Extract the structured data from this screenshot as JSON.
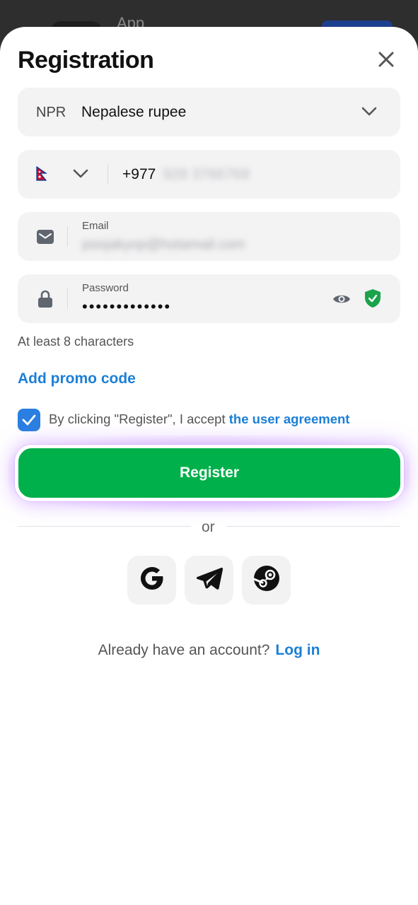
{
  "background_app": {
    "title": "App"
  },
  "sheet": {
    "title": "Registration",
    "close_icon": "close-icon"
  },
  "currency": {
    "code": "NPR",
    "name": "Nepalese rupee",
    "icon": "chevron-down-icon"
  },
  "phone": {
    "country_flag": "nepal-flag-icon",
    "prefix": "+977",
    "number_blurred": "928 3766769"
  },
  "email": {
    "label": "Email",
    "value_blurred": "poojakyop@hotamail.com",
    "icon": "envelope-icon"
  },
  "password": {
    "label": "Password",
    "value_masked": "•••••••••••••",
    "icon": "lock-icon",
    "reveal_icon": "eye-icon",
    "strength_icon": "shield-check-icon"
  },
  "password_hint": "At least 8 characters",
  "promo_link": "Add promo code",
  "agreement": {
    "checked": true,
    "text": "By clicking \"Register\", I accept",
    "link_text": "the user agreement"
  },
  "register_button": "Register",
  "divider_text": "or",
  "social": [
    {
      "name": "google",
      "icon": "google-icon"
    },
    {
      "name": "telegram",
      "icon": "telegram-icon"
    },
    {
      "name": "steam",
      "icon": "steam-icon"
    }
  ],
  "login": {
    "prompt": "Already have an account?",
    "link": "Log in"
  },
  "colors": {
    "accent": "#1c7fd6",
    "primary_button": "#00b04a",
    "checkbox": "#2a7fe0",
    "shield": "#1aa34a",
    "field_bg": "#f3f3f4"
  }
}
